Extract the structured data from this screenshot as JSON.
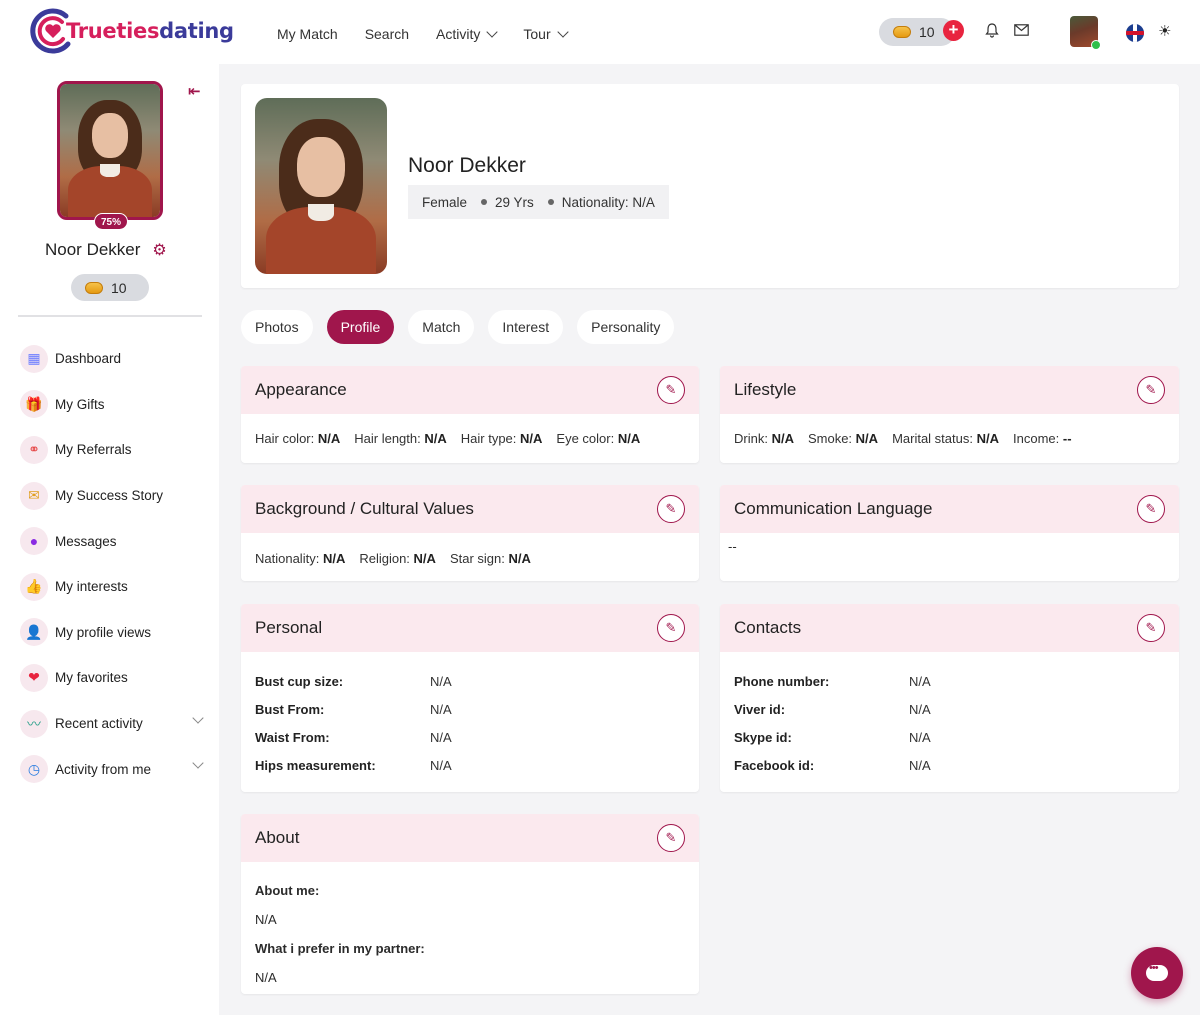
{
  "brand": {
    "name_part1": "Trueties",
    "name_part2": "dating"
  },
  "nav": [
    {
      "label": "My Match",
      "dropdown": false
    },
    {
      "label": "Search",
      "dropdown": false
    },
    {
      "label": "Activity",
      "dropdown": true
    },
    {
      "label": "Tour",
      "dropdown": true
    }
  ],
  "header": {
    "coins": "10",
    "plus": "+"
  },
  "sidebar": {
    "profile_percent": "75%",
    "name": "Noor Dekker",
    "coins": "10",
    "items": [
      {
        "label": "Dashboard",
        "icon": "dashboard-icon",
        "glyph": "▦"
      },
      {
        "label": "My Gifts",
        "icon": "gift-icon",
        "glyph": "🎁"
      },
      {
        "label": "My Referrals",
        "icon": "share-icon",
        "glyph": "⚭"
      },
      {
        "label": "My Success Story",
        "icon": "success-story-icon",
        "glyph": "✉"
      },
      {
        "label": "Messages",
        "icon": "message-icon",
        "glyph": "💬"
      },
      {
        "label": "My interests",
        "icon": "thumbs-up-icon",
        "glyph": "👍"
      },
      {
        "label": "My profile views",
        "icon": "user-icon",
        "glyph": "👤"
      },
      {
        "label": "My favorites",
        "icon": "heart-icon",
        "glyph": "❤"
      },
      {
        "label": "Recent activity",
        "icon": "pulse-icon",
        "glyph": "〰"
      },
      {
        "label": "Activity from me",
        "icon": "clock-icon",
        "glyph": "◷"
      }
    ]
  },
  "profile": {
    "name": "Noor Dekker",
    "gender": "Female",
    "age": "29 Yrs",
    "nationality": "Nationality: N/A"
  },
  "tabs": [
    "Photos",
    "Profile",
    "Match",
    "Interest",
    "Personality"
  ],
  "active_tab": "Profile",
  "appearance": {
    "title": "Appearance",
    "fields": [
      {
        "label": "Hair color:",
        "value": "N/A"
      },
      {
        "label": "Hair length:",
        "value": "N/A"
      },
      {
        "label": "Hair type:",
        "value": "N/A"
      },
      {
        "label": "Eye color:",
        "value": "N/A"
      }
    ]
  },
  "lifestyle": {
    "title": "Lifestyle",
    "fields": [
      {
        "label": "Drink:",
        "value": "N/A"
      },
      {
        "label": "Smoke:",
        "value": "N/A"
      },
      {
        "label": "Marital status:",
        "value": "N/A"
      },
      {
        "label": "Income:",
        "value": "--"
      }
    ]
  },
  "background": {
    "title": "Background / Cultural Values",
    "fields": [
      {
        "label": "Nationality:",
        "value": "N/A"
      },
      {
        "label": "Religion:",
        "value": "N/A"
      },
      {
        "label": "Star sign:",
        "value": "N/A"
      }
    ]
  },
  "language": {
    "title": "Communication Language",
    "value": "--"
  },
  "personal": {
    "title": "Personal",
    "fields": [
      {
        "label": "Bust cup size:",
        "value": "N/A"
      },
      {
        "label": "Bust From:",
        "value": "N/A"
      },
      {
        "label": "Waist From:",
        "value": "N/A"
      },
      {
        "label": "Hips measurement:",
        "value": "N/A"
      }
    ]
  },
  "contacts": {
    "title": "Contacts",
    "fields": [
      {
        "label": "Phone number:",
        "value": "N/A"
      },
      {
        "label": "Viver id:",
        "value": "N/A"
      },
      {
        "label": "Skype id:",
        "value": "N/A"
      },
      {
        "label": "Facebook id:",
        "value": "N/A"
      }
    ]
  },
  "about": {
    "title": "About",
    "about_me_label": "About me:",
    "about_me_value": "N/A",
    "partner_label": "What i prefer in my partner:",
    "partner_value": "N/A"
  },
  "colors": {
    "accent": "#a0164c",
    "section_head": "#fbe9ee",
    "brand_pink": "#d61f5c",
    "brand_blue": "#3b3b9a"
  }
}
